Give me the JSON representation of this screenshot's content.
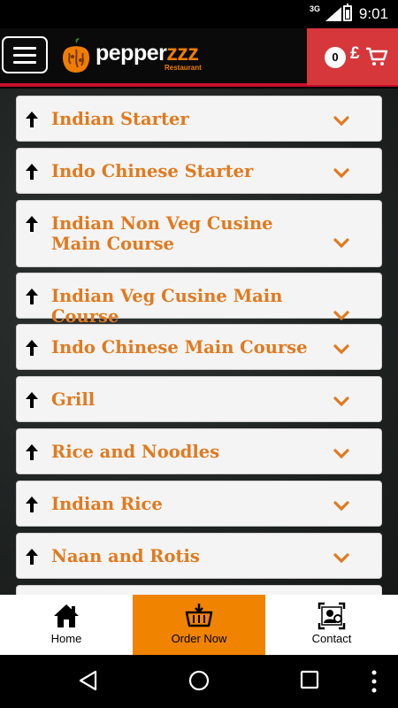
{
  "status_bar": {
    "network": "3G",
    "time": "9:01"
  },
  "header": {
    "menu_icon": "hamburger-icon",
    "logo": {
      "icon": "pepper-logo-icon",
      "text_main": "pepper",
      "text_accent": "zzz",
      "subtitle": "Restaurant"
    }
  },
  "cart": {
    "count": "0",
    "currency": "£",
    "icon": "cart-icon",
    "color": "#d6373a"
  },
  "categories": [
    {
      "label": "Indian Starter"
    },
    {
      "label": "Indo Chinese Starter"
    },
    {
      "label": "Indian Non Veg Cusine Main Course"
    },
    {
      "label": "Indian Veg Cusine Main Course"
    },
    {
      "label": "Indo Chinese Main Course"
    },
    {
      "label": "Grill"
    },
    {
      "label": "Rice and Noodles"
    },
    {
      "label": "Indian Rice"
    },
    {
      "label": "Naan and Rotis"
    }
  ],
  "bottom_nav": [
    {
      "label": "Home",
      "icon": "home-icon"
    },
    {
      "label": "Order Now",
      "icon": "order-basket-icon",
      "active": true
    },
    {
      "label": "Contact",
      "icon": "contact-card-icon"
    }
  ],
  "system_nav": {
    "back": "back-icon",
    "home": "home-circle-icon",
    "recents": "recents-icon"
  },
  "colors": {
    "accent": "#ef7d00",
    "category_text": "#e07a1f",
    "active_tab": "#f08300",
    "header_rule": "#c8102e"
  }
}
